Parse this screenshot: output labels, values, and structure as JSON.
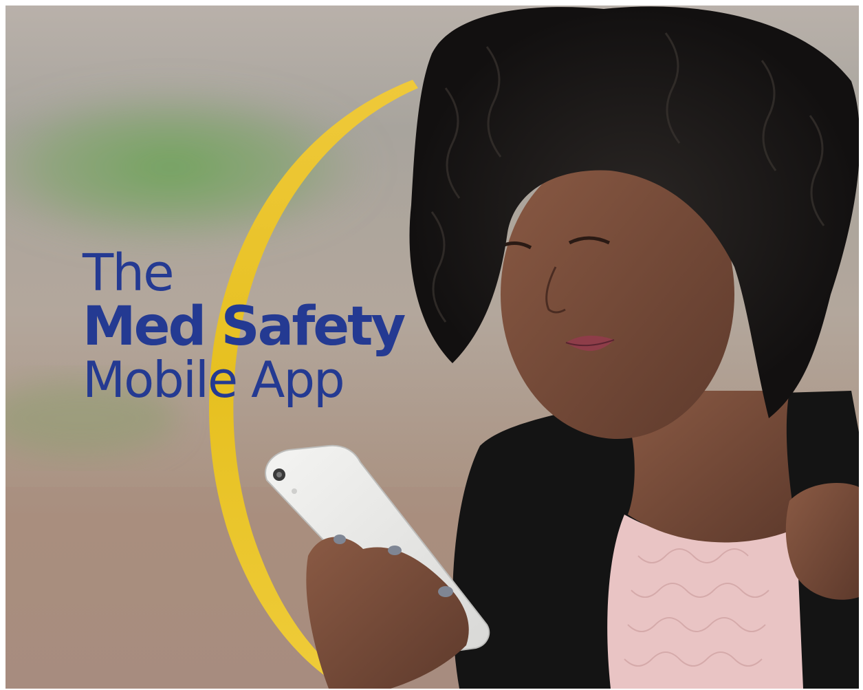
{
  "headline": {
    "line1": "The",
    "line2": "Med Safety",
    "line3": "Mobile App"
  },
  "colors": {
    "headline_text": "#243a92",
    "accent_arc": "#e8c21c",
    "background_top": "#b4aca4",
    "background_green": "#6fa15c",
    "background_ground": "#a98f82"
  },
  "image": {
    "subject": "young-woman-looking-at-white-smartphone",
    "icon_names": [
      "yellow-arc",
      "smartphone-icon"
    ]
  }
}
